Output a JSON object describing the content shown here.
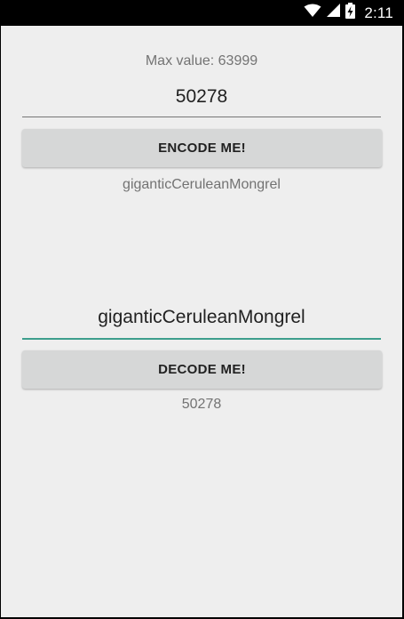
{
  "status_bar": {
    "time": "2:11",
    "icons": [
      "wifi-icon",
      "signal-icon",
      "battery-charging-icon"
    ]
  },
  "encoder": {
    "max_label": "Max value: 63999",
    "number_value": "50278",
    "encode_button": "ENCODE ME!",
    "encode_result": "giganticCeruleanMongrel"
  },
  "decoder": {
    "name_value": "giganticCeruleanMongrel",
    "decode_button": "DECODE ME!",
    "decode_result": "50278"
  },
  "colors": {
    "background": "#eeeeee",
    "button": "#d6d7d7",
    "accent_underline": "#3d9e8d",
    "status_bar": "#000000"
  }
}
